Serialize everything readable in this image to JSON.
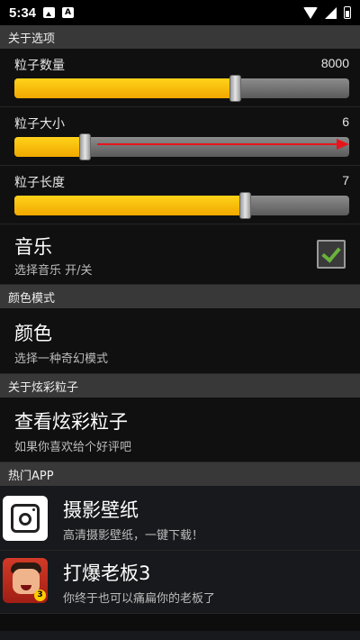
{
  "status_bar": {
    "time": "5:34",
    "icons": [
      "image-icon",
      "a-icon",
      "wifi-icon",
      "signal-icon",
      "battery-icon"
    ]
  },
  "sections": {
    "about_options": "关于选项",
    "color_mode": "颜色模式",
    "about_particles": "关于炫彩粒子",
    "hot_apps": "热门APP"
  },
  "sliders": {
    "count": {
      "label": "粒子数量",
      "value": "8000",
      "fraction": 0.66
    },
    "size": {
      "label": "粒子大小",
      "value": "6",
      "fraction": 0.21
    },
    "length": {
      "label": "粒子长度",
      "value": "7",
      "fraction": 0.69
    }
  },
  "music": {
    "title": "音乐",
    "summary": "选择音乐 开/关",
    "checked": true
  },
  "color": {
    "title": "颜色",
    "summary": "选择一种奇幻模式"
  },
  "view_particles": {
    "title": "查看炫彩粒子",
    "summary": "如果你喜欢给个好评吧"
  },
  "apps": [
    {
      "title": "摄影壁纸",
      "summary": "高清摄影壁纸，一键下载！",
      "icon": "camera-icon"
    },
    {
      "title": "打爆老板3",
      "summary": "你终于也可以痛扁你的老板了",
      "icon": "boss-game-icon",
      "badge": "3"
    }
  ],
  "colors": {
    "accent_fill": "#ffc107",
    "arrow": "#e8141c",
    "check": "#69b33a"
  }
}
